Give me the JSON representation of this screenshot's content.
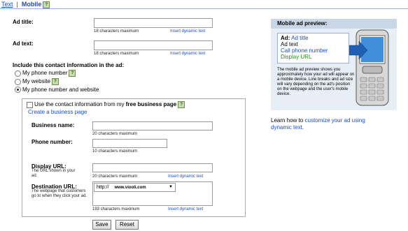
{
  "tabs": {
    "text": "Text",
    "separator": "|",
    "mobile": "Mobile",
    "help": "?"
  },
  "ad_title": {
    "label": "Ad title:",
    "hint": "18 characters maximum",
    "dynamic": "Insert dynamic text",
    "value": ""
  },
  "ad_text": {
    "label": "Ad text:",
    "hint": "18 characters maximum",
    "dynamic": "Insert dynamic text",
    "value": ""
  },
  "contact": {
    "heading": "Include this contact information in the ad:",
    "options": [
      {
        "label": "My phone number",
        "selected": false
      },
      {
        "label": "My website",
        "selected": false
      },
      {
        "label": "My phone number and website",
        "selected": true
      }
    ]
  },
  "business": {
    "checkbox_prefix": "Use the contact information from my",
    "checkbox_bold": "free business page",
    "create_link": "Create a business page",
    "name_label": "Business name:",
    "name_hint": "20 characters maximum",
    "phone_label": "Phone number:",
    "phone_hint": "10 characters maximum",
    "display_label": "Display URL:",
    "display_sub": "The URL shown in your ad.",
    "display_hint": "20 characters maximum",
    "display_dynamic": "Insert dynamic text",
    "dest_label": "Destination URL:",
    "dest_sub": "The webpage that customers go to when they click your ad.",
    "dest_protocol": "http://",
    "dest_value": "www.viooli.com",
    "dest_hint": "193 characters maximum",
    "dest_dynamic": "Insert dynamic text"
  },
  "buttons": {
    "save": "Save",
    "reset": "Reset"
  },
  "preview": {
    "title": "Mobile ad preview:",
    "ad_label": "Ad:",
    "ad_title": "Ad title",
    "ad_text": "Ad text",
    "phone": "Call phone number",
    "url": "Display URL",
    "description": "The mobile ad preview shows you approximately how your ad will appear on a mobile device. Line breaks and ad size will vary depending on the ad's position on the webpage and the user's mobile device."
  },
  "learn": {
    "prefix": "Learn how to",
    "link": "customize your ad using dynamic text",
    "suffix": "."
  },
  "colors": {
    "link": "#1c4fb3",
    "panel": "#e7eef6",
    "panel_header": "#c9d6e6",
    "url_green": "#2a8a1f"
  }
}
